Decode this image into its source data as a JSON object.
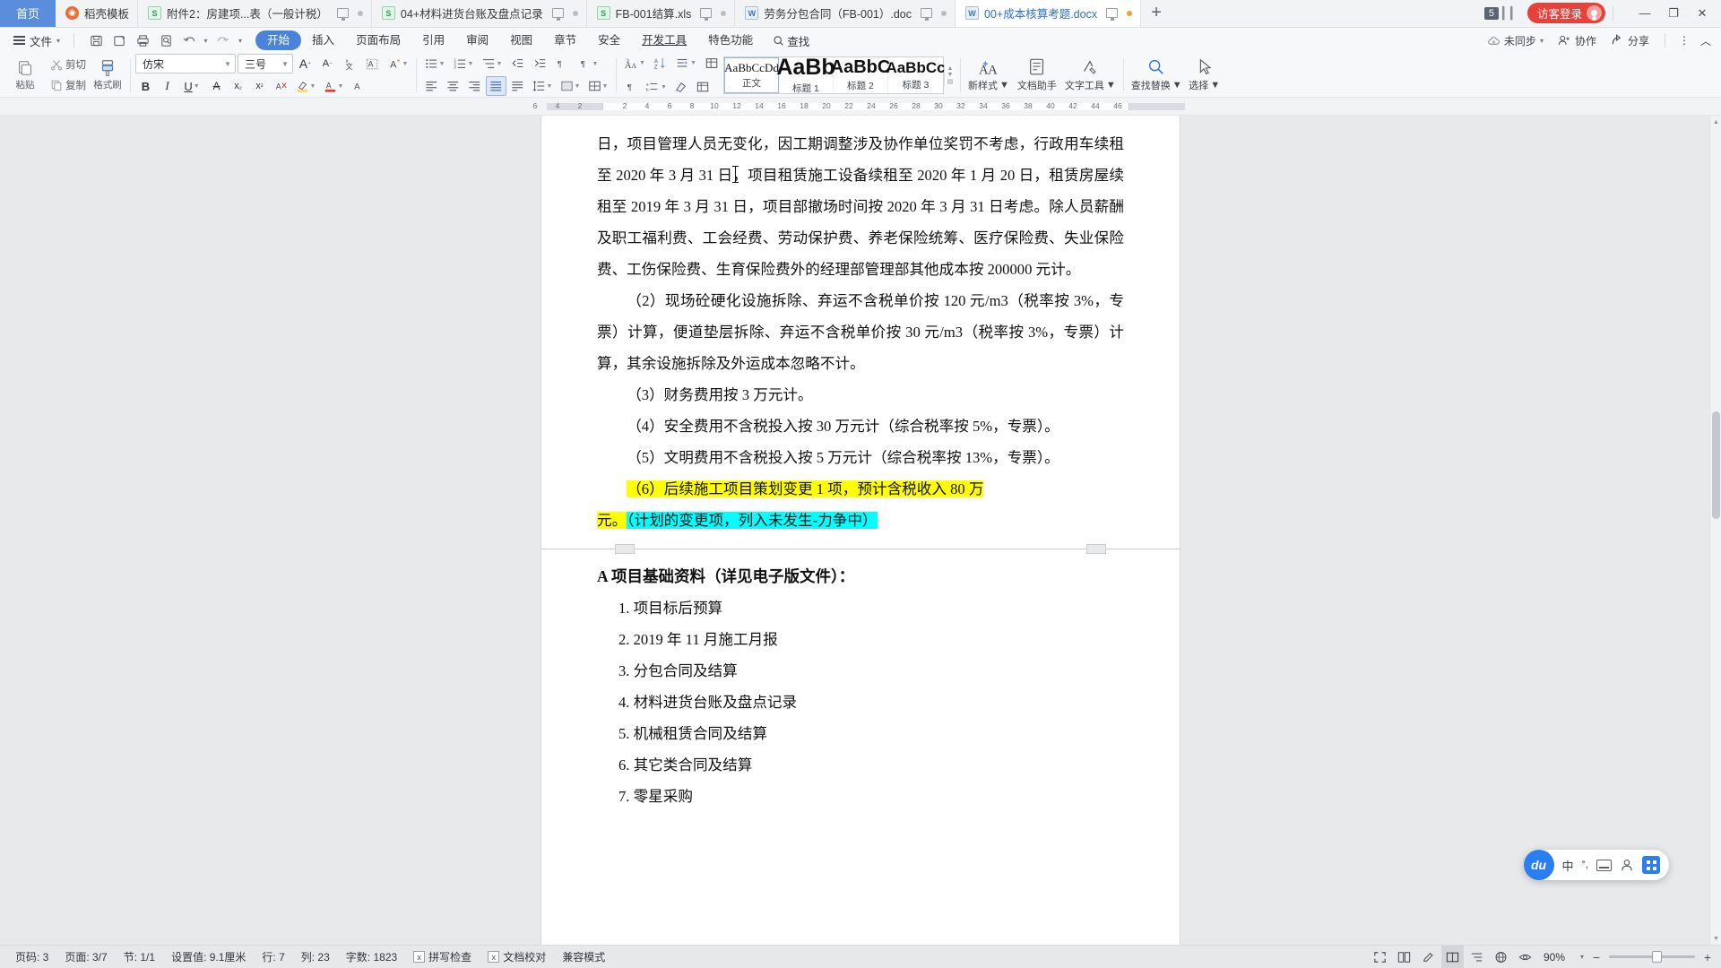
{
  "tabbar": {
    "home_label": "首页",
    "tabs": [
      {
        "label": "稻壳模板",
        "icon": "dock-template-icon",
        "type": "dock",
        "active": false,
        "has_monitor": false,
        "has_dot": false
      },
      {
        "label": "附件2：房建项...表（一般计税）",
        "icon": "excel-icon",
        "type": "s",
        "active": false,
        "has_monitor": true,
        "has_dot": true
      },
      {
        "label": "04+材料进货台账及盘点记录",
        "icon": "excel-icon",
        "type": "s",
        "active": false,
        "has_monitor": true,
        "has_dot": true
      },
      {
        "label": "FB-001结算.xls",
        "icon": "excel-icon",
        "type": "s",
        "active": false,
        "has_monitor": true,
        "has_dot": true
      },
      {
        "label": "劳务分包合同（FB-001）.doc",
        "icon": "word-icon",
        "type": "w",
        "active": false,
        "has_monitor": true,
        "has_dot": true
      },
      {
        "label": "00+成本核算考题.docx",
        "icon": "word-icon",
        "type": "w",
        "active": true,
        "has_monitor": true,
        "has_dot": true
      }
    ],
    "new_tab_label": "+",
    "tab_count_badge": "5",
    "login_label": "访客登录",
    "minimize": "—",
    "maximize": "❐",
    "close": "✕"
  },
  "menubar": {
    "file_label": "文件",
    "quick_access": [
      "save-icon",
      "print-preview-icon",
      "print-icon",
      "search-doc-icon",
      "undo-icon",
      "redo-icon",
      "customize-icon"
    ],
    "items": [
      {
        "label": "开始",
        "active": true
      },
      {
        "label": "插入",
        "active": false
      },
      {
        "label": "页面布局",
        "active": false
      },
      {
        "label": "引用",
        "active": false
      },
      {
        "label": "审阅",
        "active": false
      },
      {
        "label": "视图",
        "active": false
      },
      {
        "label": "章节",
        "active": false
      },
      {
        "label": "安全",
        "active": false
      },
      {
        "label": "开发工具",
        "active": false,
        "underline": true
      },
      {
        "label": "特色功能",
        "active": false
      }
    ],
    "find_label": "查找",
    "right": [
      {
        "label": "未同步",
        "icon": "cloud-sync-icon"
      },
      {
        "label": "协作",
        "icon": "collaborate-icon"
      },
      {
        "label": "分享",
        "icon": "share-icon"
      }
    ],
    "more_label": "⋮",
    "collapse_label": "︿"
  },
  "ribbon": {
    "paste_label": "粘贴",
    "cut_label": "剪切",
    "copy_label": "复制",
    "format_painter_label": "格式刷",
    "font_name": "仿宋",
    "font_size": "三号",
    "grow_font": "A⁺",
    "shrink_font": "A⁻",
    "buttons_row1": [
      "增大字号",
      "减小字号",
      "拼音指南",
      "字符边框",
      "文字突出显示"
    ],
    "bold": "B",
    "italic": "I",
    "underline": "U",
    "strikethrough": "abc",
    "subscript": "x₂",
    "superscript": "x²",
    "clear_format": "清除格式",
    "text_highlight": "突出显示",
    "font_color": "字体颜色",
    "char_shading": "字符底纹",
    "styles": [
      {
        "preview": "AaBbCcDd",
        "label": "正文",
        "selected": true,
        "size": 13
      },
      {
        "preview": "AaBb",
        "label": "标题 1",
        "selected": false,
        "size": 25
      },
      {
        "preview": "AaBbC",
        "label": "标题 2",
        "selected": false,
        "size": 20
      },
      {
        "preview": "AaBbCc",
        "label": "标题 3",
        "selected": false,
        "size": 17
      }
    ],
    "new_style_label": "新样式",
    "doc_assistant_label": "文档助手",
    "text_tools_label": "文字工具",
    "find_replace_label": "查找替换",
    "select_label": "选择"
  },
  "ruler": {
    "left_ticks": [
      "6",
      "4",
      "2"
    ],
    "ticks": [
      "2",
      "4",
      "6",
      "8",
      "10",
      "12",
      "14",
      "16",
      "18",
      "20",
      "22",
      "24",
      "26",
      "28",
      "30",
      "32",
      "34",
      "36",
      "38",
      "40",
      "42",
      "44",
      "46"
    ]
  },
  "document": {
    "paragraphs": [
      {
        "id": "p1",
        "text": "日，项目管理人员无变化，因工期调整涉及协作单位奖罚不考虑，行政用车续租至 2020 年 3 月 31 日，项目租赁施工设备续租至 2020 年 1 月 20 日，租赁房屋续租至 2019 年 3 月 31 日，项目部撤场时间按 2020 年 3 月 31 日考虑。除人员薪酬及职工福利费、工会经费、劳动保护费、养老保险统筹、医疗保险费、失业保险费、工伤保险费、生育保险费外的经理部管理部其他成本按 200000 元计。",
        "indent": false
      },
      {
        "id": "p2",
        "text": "（2）现场砼硬化设施拆除、弃运不含税单价按 120 元/m3（税率按 3%，专票）计算，便道垫层拆除、弃运不含税单价按 30 元/m3（税率按 3%，专票）计算，其余设施拆除及外运成本忽略不计。",
        "indent": true
      },
      {
        "id": "p3",
        "text": "（3）财务费用按 3 万元计。",
        "indent": true
      },
      {
        "id": "p4",
        "text": "（4）安全费用不含税投入按 30 万元计（综合税率按 5%，专票）。",
        "indent": true
      },
      {
        "id": "p5",
        "text": "（5）文明费用不含税投入按 5 万元计（综合税率按 13%，专票）。",
        "indent": true
      }
    ],
    "highlighted_paragraph": {
      "yellow_part_a": "（6）后续施工项目策划变更 1 项，预计含税收入 80 万",
      "yellow_part_b": "元。",
      "cyan_part": "（计划的变更项，列入未发生-力争中）"
    },
    "next_page": {
      "heading": "A 项目基础资料（详见电子版文件）：",
      "list": [
        "1.  项目标后预算",
        "2.  2019 年 11 月施工月报",
        "3.  分包合同及结算",
        "4.  材料进货台账及盘点记录",
        "5.  机械租赁合同及结算",
        "6.  其它类合同及结算",
        "7.  零星采购"
      ]
    }
  },
  "ime": {
    "logo": "du",
    "mode_label": "中",
    "punct_label": "°,",
    "keyboard_icon": "keyboard-icon",
    "user_icon": "user-icon",
    "panel_icon": "panel-icon"
  },
  "statusbar": {
    "page_number": "页码: 3",
    "page_of": "页面: 3/7",
    "section": "节: 1/1",
    "setting_value": "设置值: 9.1厘米",
    "row": "行: 7",
    "col": "列: 23",
    "word_count": "字数: 1823",
    "spell_check": "拼写检查",
    "doc_proof": "文档校对",
    "compat_mode": "兼容模式",
    "view_icons": [
      "fullscreen-icon",
      "page-layout-icon",
      "edit-mode-icon",
      "reading-layout-icon",
      "outline-icon",
      "web-layout-icon",
      "protect-eye-icon"
    ],
    "zoom_label": "90%",
    "zoom_out": "−",
    "zoom_in": "+"
  },
  "colors": {
    "accent": "#4a84d8",
    "tab_active_text": "#2b6fd0",
    "login_red": "#e8413b",
    "highlight_yellow": "#ffff00",
    "highlight_cyan": "#00ffff"
  }
}
